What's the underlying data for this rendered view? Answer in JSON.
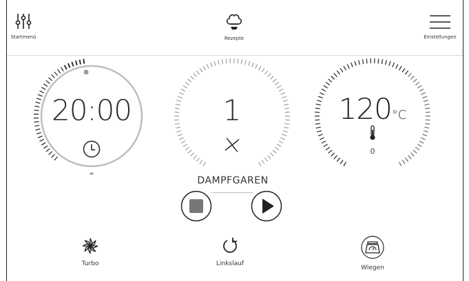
{
  "topbar": {
    "startmenu_label": "Startmenü",
    "rezepte_label": "Rezepte",
    "einstellungen_label": "Einstellungen"
  },
  "timer": {
    "value": "20:00",
    "icon": "clock-icon"
  },
  "speed": {
    "value": "1",
    "icon": "blade-icon"
  },
  "temperature": {
    "value": "120",
    "unit": "°C",
    "sub_value": "0",
    "icon": "thermometer-icon"
  },
  "program": {
    "label": "DAMPFGAREN"
  },
  "controls": {
    "stop_icon": "stop-icon",
    "play_icon": "play-icon"
  },
  "bottom": {
    "turbo_label": "Turbo",
    "linkslauf_label": "Linkslauf",
    "wiegen_label": "Wiegen"
  },
  "colors": {
    "ink": "#2a2a2a",
    "ring": "#bdbdbd",
    "stop_fill": "#777777",
    "background": "#ffffff"
  }
}
